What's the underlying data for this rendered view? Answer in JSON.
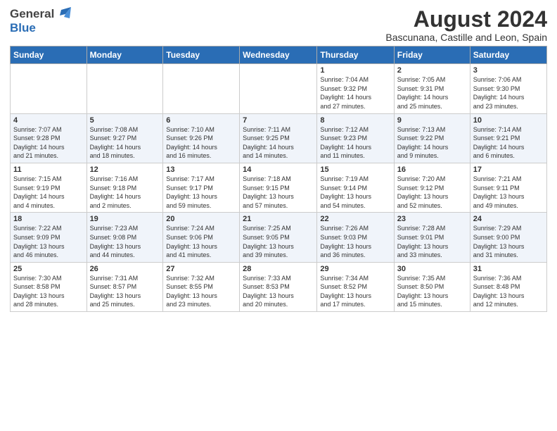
{
  "logo": {
    "general": "General",
    "blue": "Blue"
  },
  "title": "August 2024",
  "subtitle": "Bascunana, Castille and Leon, Spain",
  "days_of_week": [
    "Sunday",
    "Monday",
    "Tuesday",
    "Wednesday",
    "Thursday",
    "Friday",
    "Saturday"
  ],
  "weeks": [
    [
      {
        "day": "",
        "info": ""
      },
      {
        "day": "",
        "info": ""
      },
      {
        "day": "",
        "info": ""
      },
      {
        "day": "",
        "info": ""
      },
      {
        "day": "1",
        "info": "Sunrise: 7:04 AM\nSunset: 9:32 PM\nDaylight: 14 hours\nand 27 minutes."
      },
      {
        "day": "2",
        "info": "Sunrise: 7:05 AM\nSunset: 9:31 PM\nDaylight: 14 hours\nand 25 minutes."
      },
      {
        "day": "3",
        "info": "Sunrise: 7:06 AM\nSunset: 9:30 PM\nDaylight: 14 hours\nand 23 minutes."
      }
    ],
    [
      {
        "day": "4",
        "info": "Sunrise: 7:07 AM\nSunset: 9:28 PM\nDaylight: 14 hours\nand 21 minutes."
      },
      {
        "day": "5",
        "info": "Sunrise: 7:08 AM\nSunset: 9:27 PM\nDaylight: 14 hours\nand 18 minutes."
      },
      {
        "day": "6",
        "info": "Sunrise: 7:10 AM\nSunset: 9:26 PM\nDaylight: 14 hours\nand 16 minutes."
      },
      {
        "day": "7",
        "info": "Sunrise: 7:11 AM\nSunset: 9:25 PM\nDaylight: 14 hours\nand 14 minutes."
      },
      {
        "day": "8",
        "info": "Sunrise: 7:12 AM\nSunset: 9:23 PM\nDaylight: 14 hours\nand 11 minutes."
      },
      {
        "day": "9",
        "info": "Sunrise: 7:13 AM\nSunset: 9:22 PM\nDaylight: 14 hours\nand 9 minutes."
      },
      {
        "day": "10",
        "info": "Sunrise: 7:14 AM\nSunset: 9:21 PM\nDaylight: 14 hours\nand 6 minutes."
      }
    ],
    [
      {
        "day": "11",
        "info": "Sunrise: 7:15 AM\nSunset: 9:19 PM\nDaylight: 14 hours\nand 4 minutes."
      },
      {
        "day": "12",
        "info": "Sunrise: 7:16 AM\nSunset: 9:18 PM\nDaylight: 14 hours\nand 2 minutes."
      },
      {
        "day": "13",
        "info": "Sunrise: 7:17 AM\nSunset: 9:17 PM\nDaylight: 13 hours\nand 59 minutes."
      },
      {
        "day": "14",
        "info": "Sunrise: 7:18 AM\nSunset: 9:15 PM\nDaylight: 13 hours\nand 57 minutes."
      },
      {
        "day": "15",
        "info": "Sunrise: 7:19 AM\nSunset: 9:14 PM\nDaylight: 13 hours\nand 54 minutes."
      },
      {
        "day": "16",
        "info": "Sunrise: 7:20 AM\nSunset: 9:12 PM\nDaylight: 13 hours\nand 52 minutes."
      },
      {
        "day": "17",
        "info": "Sunrise: 7:21 AM\nSunset: 9:11 PM\nDaylight: 13 hours\nand 49 minutes."
      }
    ],
    [
      {
        "day": "18",
        "info": "Sunrise: 7:22 AM\nSunset: 9:09 PM\nDaylight: 13 hours\nand 46 minutes."
      },
      {
        "day": "19",
        "info": "Sunrise: 7:23 AM\nSunset: 9:08 PM\nDaylight: 13 hours\nand 44 minutes."
      },
      {
        "day": "20",
        "info": "Sunrise: 7:24 AM\nSunset: 9:06 PM\nDaylight: 13 hours\nand 41 minutes."
      },
      {
        "day": "21",
        "info": "Sunrise: 7:25 AM\nSunset: 9:05 PM\nDaylight: 13 hours\nand 39 minutes."
      },
      {
        "day": "22",
        "info": "Sunrise: 7:26 AM\nSunset: 9:03 PM\nDaylight: 13 hours\nand 36 minutes."
      },
      {
        "day": "23",
        "info": "Sunrise: 7:28 AM\nSunset: 9:01 PM\nDaylight: 13 hours\nand 33 minutes."
      },
      {
        "day": "24",
        "info": "Sunrise: 7:29 AM\nSunset: 9:00 PM\nDaylight: 13 hours\nand 31 minutes."
      }
    ],
    [
      {
        "day": "25",
        "info": "Sunrise: 7:30 AM\nSunset: 8:58 PM\nDaylight: 13 hours\nand 28 minutes."
      },
      {
        "day": "26",
        "info": "Sunrise: 7:31 AM\nSunset: 8:57 PM\nDaylight: 13 hours\nand 25 minutes."
      },
      {
        "day": "27",
        "info": "Sunrise: 7:32 AM\nSunset: 8:55 PM\nDaylight: 13 hours\nand 23 minutes."
      },
      {
        "day": "28",
        "info": "Sunrise: 7:33 AM\nSunset: 8:53 PM\nDaylight: 13 hours\nand 20 minutes."
      },
      {
        "day": "29",
        "info": "Sunrise: 7:34 AM\nSunset: 8:52 PM\nDaylight: 13 hours\nand 17 minutes."
      },
      {
        "day": "30",
        "info": "Sunrise: 7:35 AM\nSunset: 8:50 PM\nDaylight: 13 hours\nand 15 minutes."
      },
      {
        "day": "31",
        "info": "Sunrise: 7:36 AM\nSunset: 8:48 PM\nDaylight: 13 hours\nand 12 minutes."
      }
    ]
  ]
}
